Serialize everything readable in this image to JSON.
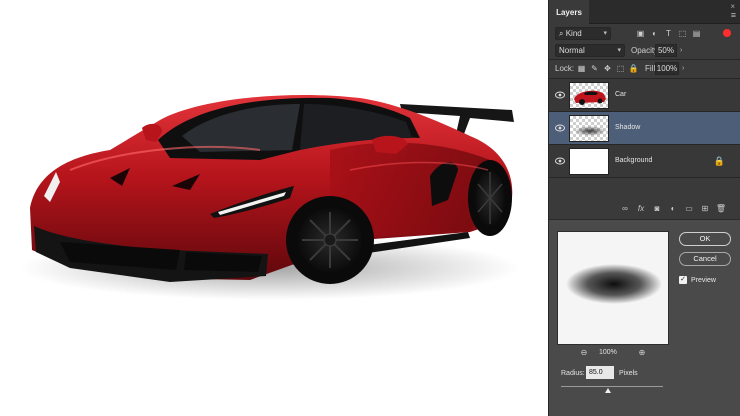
{
  "panel": {
    "tab_label": "Layers",
    "close_glyph": "×",
    "menu_glyph": "≡",
    "filter": {
      "kind_label": "Kind",
      "icons": [
        "image-filter-icon",
        "adjustment-filter-icon",
        "type-filter-icon",
        "shape-filter-icon",
        "smart-object-filter-icon"
      ],
      "switch_color": "#ff2d2d"
    },
    "blend": {
      "mode": "Normal",
      "opacity_label": "Opacity:",
      "opacity_value": "50%"
    },
    "lock": {
      "label": "Lock:",
      "fill_label": "Fill:",
      "fill_value": "100%"
    },
    "layers": [
      {
        "name": "Car",
        "selected": false
      },
      {
        "name": "Shadow",
        "selected": true
      },
      {
        "name": "Background",
        "selected": false,
        "locked": true
      }
    ],
    "footer_icons": [
      "link-icon",
      "fx-icon",
      "mask-icon",
      "adjustment-icon",
      "group-folder-icon",
      "new-layer-icon",
      "trash-icon"
    ],
    "fx_label": "fx"
  },
  "dialog": {
    "ok_label": "OK",
    "cancel_label": "Cancel",
    "preview_label": "Preview",
    "preview_checked": true,
    "zoom_value": "100%",
    "radius_label": "Radius:",
    "radius_value": "85.0",
    "radius_unit": "Pixels"
  },
  "colors": {
    "selection": "#4d5e78",
    "panel_bg": "#3a3a3a",
    "car_red": "#b5141b"
  }
}
